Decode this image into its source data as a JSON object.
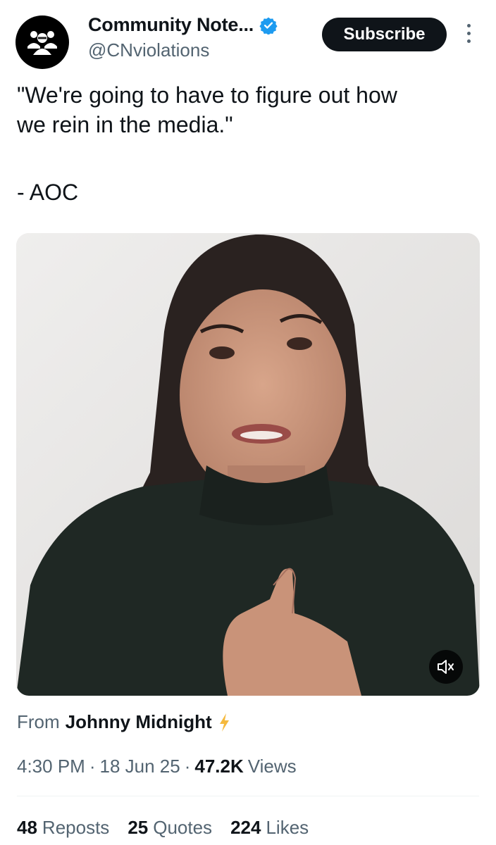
{
  "author": {
    "display_name": "Community Note...",
    "handle": "@CNviolations",
    "avatar_icon": "people-group-icon",
    "verified_icon": "verified-badge-icon"
  },
  "actions": {
    "subscribe_label": "Subscribe",
    "more_icon": "more-vertical-icon"
  },
  "tweet": {
    "text_line1": "\"We're going to have to figure out how",
    "text_line2": "we rein in the media.\"",
    "attribution": "- AOC"
  },
  "media": {
    "type": "video",
    "mute_icon": "volume-muted-icon"
  },
  "source": {
    "from_label": "From",
    "name": "Johnny Midnight",
    "bolt_icon": "lightning-icon"
  },
  "meta": {
    "time": "4:30 PM",
    "separator": "·",
    "date": "18 Jun 25",
    "views_count": "47.2K",
    "views_label": "Views"
  },
  "stats": [
    {
      "count": "48",
      "label": "Reposts"
    },
    {
      "count": "25",
      "label": "Quotes"
    },
    {
      "count": "224",
      "label": "Likes"
    }
  ],
  "colors": {
    "text_primary": "#0f1419",
    "text_secondary": "#536471",
    "verified_blue": "#1d9bf0",
    "bolt_yellow": "#f5b93d"
  }
}
